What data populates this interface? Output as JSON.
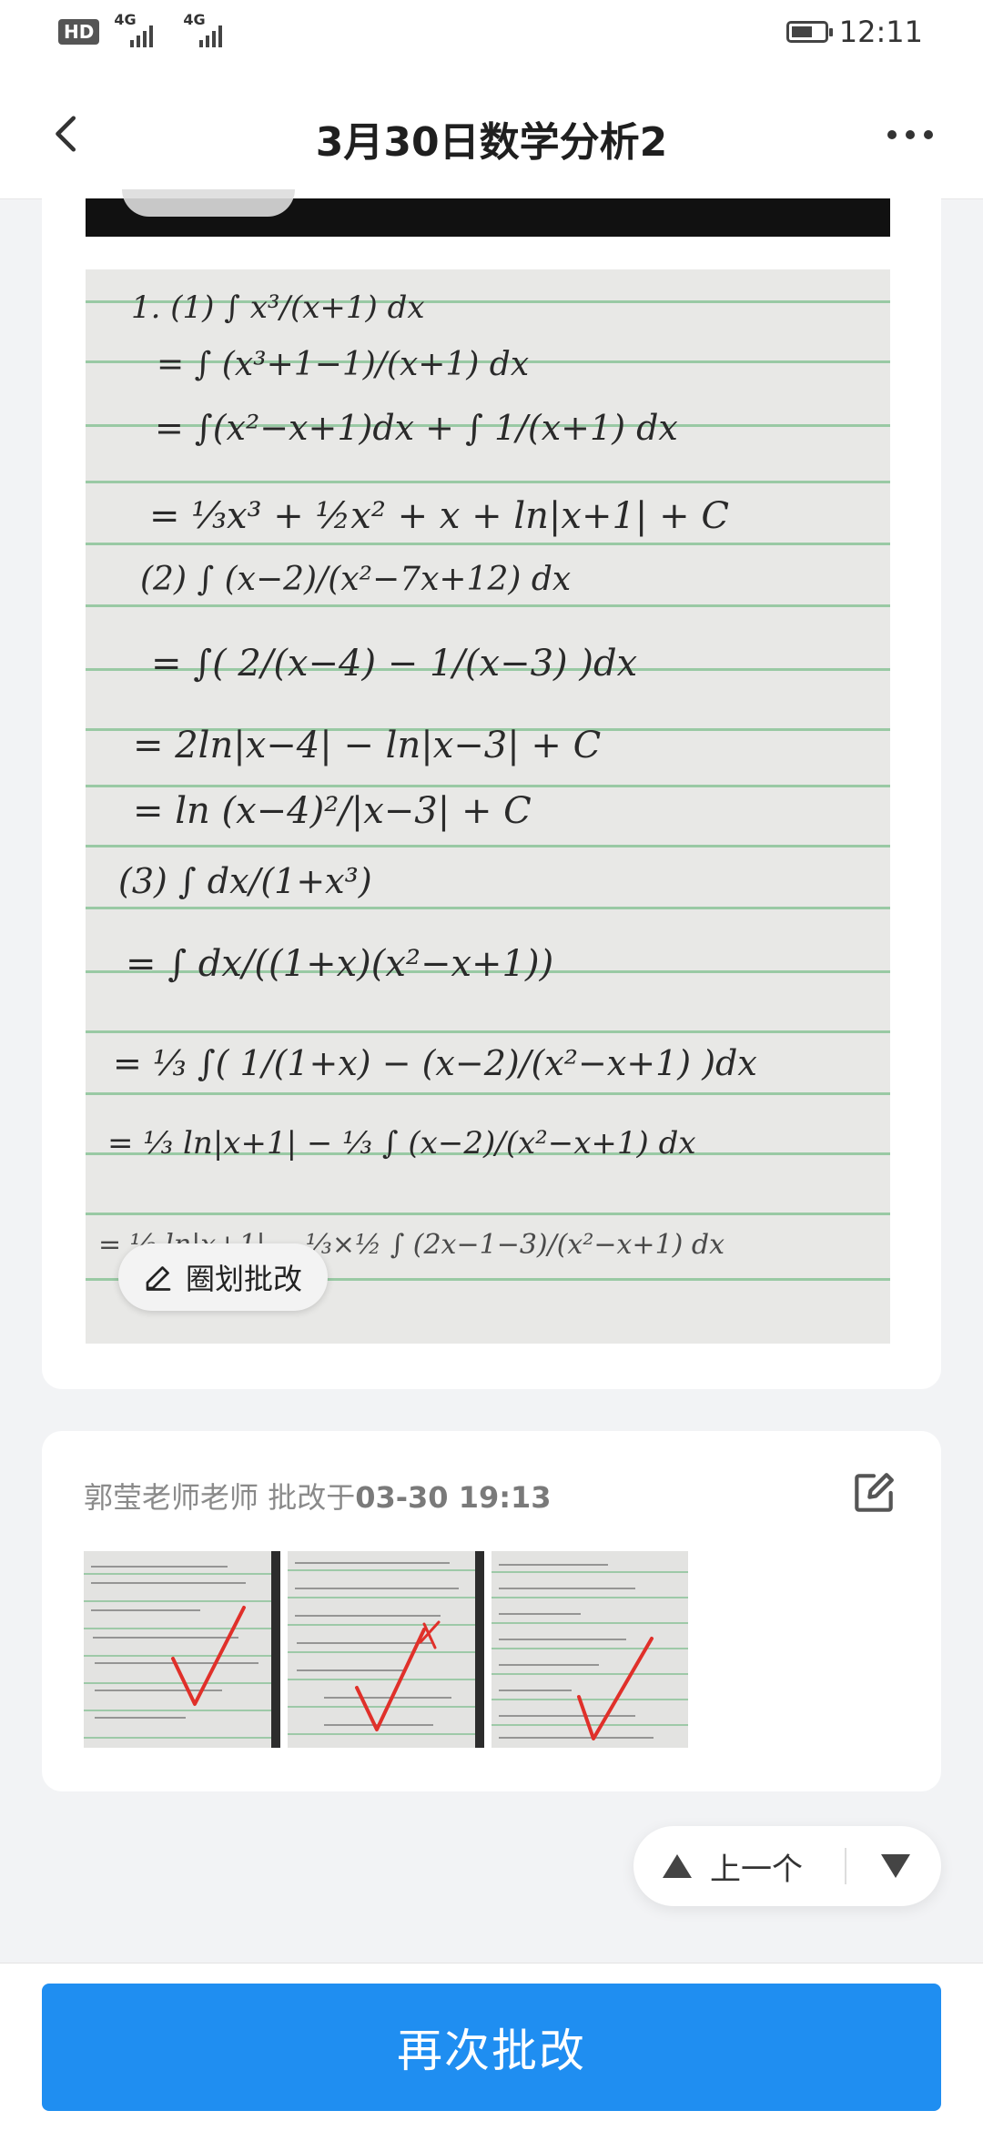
{
  "status_bar": {
    "left_badge": "HD",
    "network_1": "4G",
    "network_2": "4G",
    "time": "12:11"
  },
  "header": {
    "title": "3月30日数学分析2"
  },
  "photo": {
    "lines": [
      "1. (1) ∫ x³/(x+1) dx",
      "= ∫ (x³+1−1)/(x+1) dx",
      "= ∫(x²−x+1)dx + ∫ 1/(x+1) dx",
      "= ⅓x³ + ½x² + x + ln|x+1| + C",
      "(2) ∫ (x−2)/(x²−7x+12) dx",
      "= ∫( 2/(x−4) − 1/(x−3) )dx",
      "= 2ln|x−4| − ln|x−3| + C",
      "= ln (x−4)²/|x−3| + C",
      "(3) ∫ dx/(1+x³)",
      "= ∫ dx/((1+x)(x²−x+1))",
      "= ⅓ ∫( 1/(1+x) − (x−2)/(x²−x+1) )dx",
      "= ⅓ ln|x+1| − ⅓ ∫ (x−2)/(x²−x+1) dx",
      "= ⅓ ln|x+1| − ⅓×½ ∫ (2x−1−3)/(x²−x+1) dx"
    ],
    "annotate_button": "圈划批改"
  },
  "review": {
    "teacher": "郭莹老师老师",
    "action": "批改于",
    "time": "03-30 19:13",
    "thumbnail_count": 3
  },
  "pager": {
    "prev_label": "上一个"
  },
  "bottom": {
    "button_label": "再次批改"
  },
  "colors": {
    "primary": "#1f8ef1",
    "check_red": "#e0302a",
    "rule_green": "#7fbf8d"
  }
}
